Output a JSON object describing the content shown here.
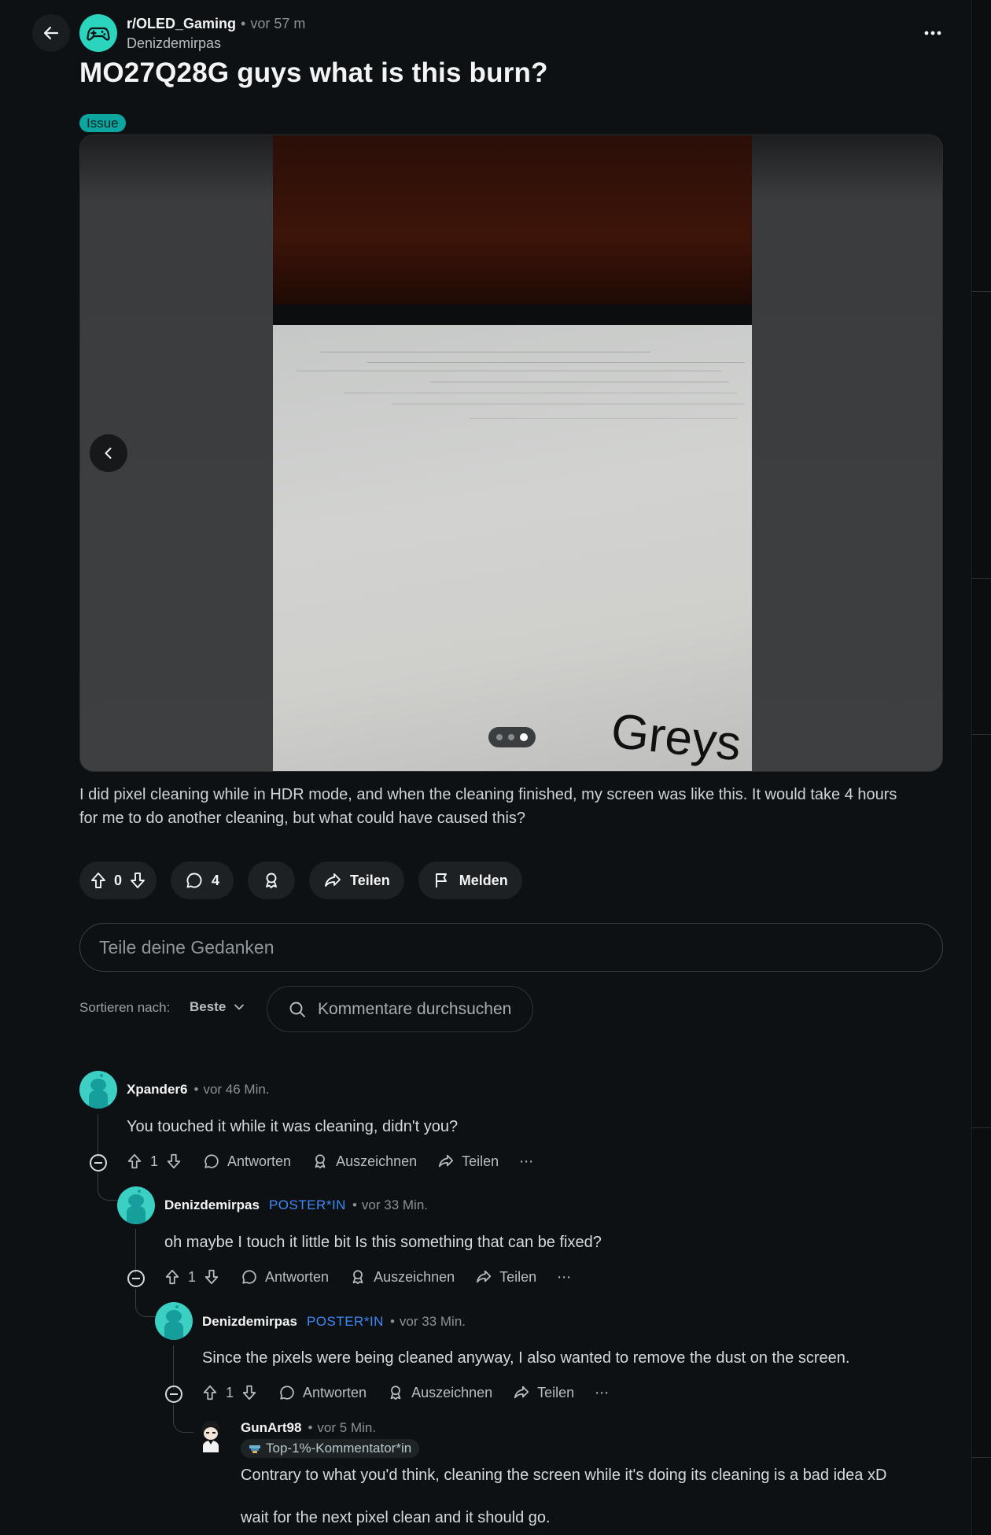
{
  "header": {
    "subreddit": "r/OLED_Gaming",
    "separator": "•",
    "time": "vor 57 m",
    "author": "Denizdemirpas",
    "more": "⋯"
  },
  "post": {
    "title": "MO27Q28G guys what is this burn?",
    "flair": "Issue",
    "image_text": "Greys",
    "gallery_pages": 3,
    "gallery_active": 3,
    "body_line1": "I did pixel cleaning while in HDR mode, and when the cleaning finished, my screen was like this. It would take 4 hours",
    "body_line2": "for me to do another cleaning, but what could have caused this?"
  },
  "actions": {
    "votes": "0",
    "comments": "4",
    "share": "Teilen",
    "report": "Melden"
  },
  "comment_input": {
    "placeholder": "Teile deine Gedanken"
  },
  "sort": {
    "label": "Sortieren nach:",
    "value": "Beste",
    "search_placeholder": "Kommentare durchsuchen"
  },
  "comments": [
    {
      "user": "Xpander6",
      "time": "vor 46 Min.",
      "text": "You touched it while it was cleaning, didn't you?",
      "votes": "1",
      "reply": "Antworten",
      "award": "Auszeichnen",
      "share": "Teilen",
      "more": "⋯"
    },
    {
      "user": "Denizdemirpas",
      "op": "POSTER*IN",
      "time": "vor 33 Min.",
      "text": "oh maybe I touch it little bit Is this something that can be fixed?",
      "votes": "1",
      "reply": "Antworten",
      "award": "Auszeichnen",
      "share": "Teilen",
      "more": "⋯"
    },
    {
      "user": "Denizdemirpas",
      "op": "POSTER*IN",
      "time": "vor 33 Min.",
      "text": "Since the pixels were being cleaned anyway, I also wanted to remove the dust on the screen.",
      "votes": "1",
      "reply": "Antworten",
      "award": "Auszeichnen",
      "share": "Teilen",
      "more": "⋯"
    },
    {
      "user": "GunArt98",
      "time": "vor 5 Min.",
      "badge": "Top-1%-Kommentator*in",
      "text_line1": "Contrary to what you'd think, cleaning the screen while it's doing its cleaning is a bad idea xD",
      "text_line2": "wait for the next pixel clean and it should go."
    }
  ],
  "colors": {
    "background": "#0e1113",
    "accent_teal": "#2ad4bd",
    "flair": "#0ca5a0",
    "op_blue": "#3d8af7"
  }
}
